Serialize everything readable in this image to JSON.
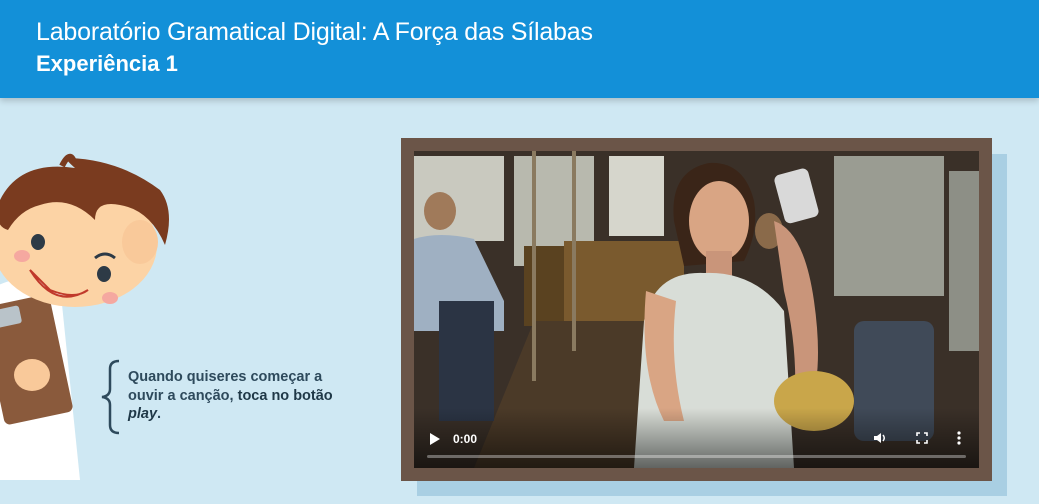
{
  "header": {
    "title": "Laboratório Gramatical Digital: A Força das Sílabas",
    "subtitle": "Experiência 1"
  },
  "instruction": {
    "text_1": "Quando quiseres começar a",
    "text_2": "ouvir a canção, ",
    "emphasis": "toca no botão",
    "play_word": "play",
    "period": "."
  },
  "video": {
    "current_time": "0:00",
    "progress": 0,
    "icons": [
      "play-icon",
      "volume-icon",
      "fullscreen-icon",
      "more-options-icon"
    ]
  },
  "colors": {
    "header": "#1390d8",
    "background": "#cfe8f3",
    "frame": "#6b5548"
  }
}
